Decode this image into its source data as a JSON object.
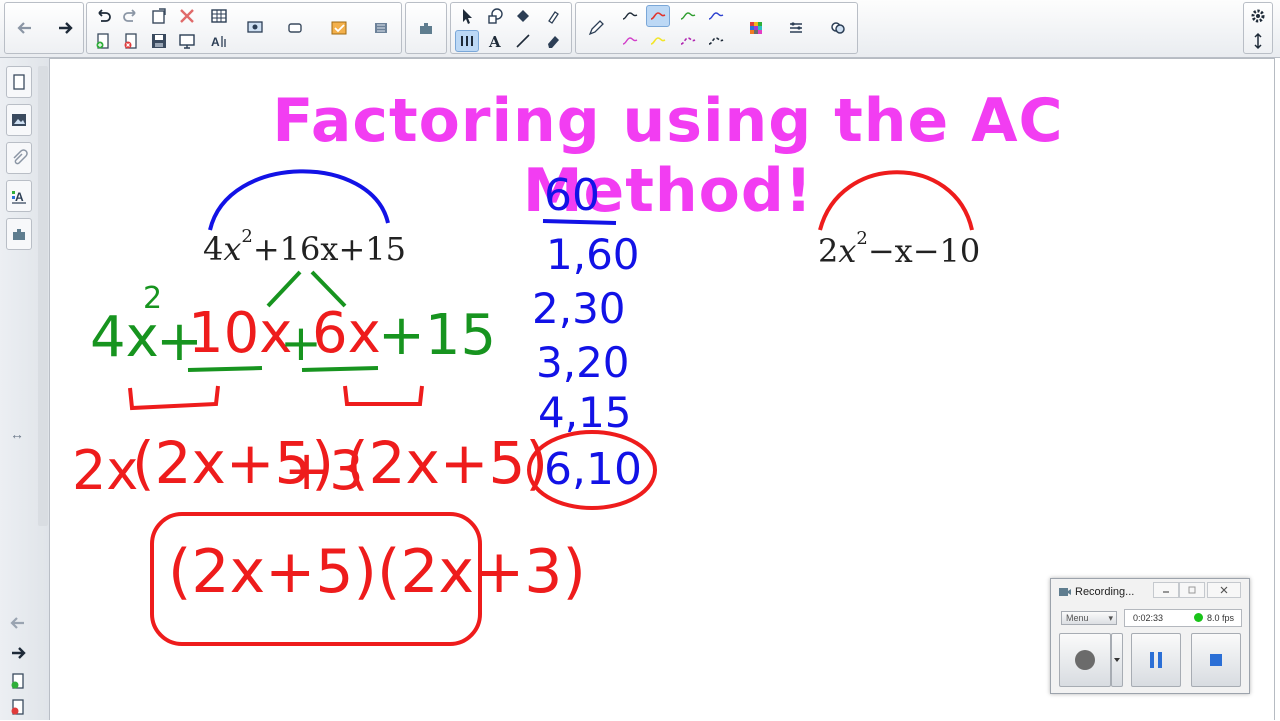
{
  "toolbar": {
    "groups": [
      "navigation",
      "edit",
      "insert",
      "pointer-shapes",
      "pens",
      "settings"
    ],
    "icons": [
      "back-arrow-icon",
      "forward-arrow-icon",
      "undo-icon",
      "redo-icon",
      "paste-icon",
      "delete-icon",
      "table-icon",
      "add-page-icon",
      "delete-page-icon",
      "save-icon",
      "screen-shade-icon",
      "text-recognition-icon",
      "capture-icon",
      "screen-icon",
      "response-icon",
      "activity-icon",
      "addons-icon",
      "select-icon",
      "shapes-icon",
      "fill-icon",
      "eraser-drop-icon",
      "measure-icon",
      "text-icon",
      "line-icon",
      "eraser-icon",
      "pen-icon",
      "pen-style-icon",
      "color-palette-icon",
      "properties-icon",
      "link-icon",
      "gear-icon",
      "move-toolbar-icon"
    ]
  },
  "sidebar": {
    "tabs": [
      "page-sorter-icon",
      "gallery-icon",
      "attachments-icon",
      "properties-icon",
      "addons-icon"
    ],
    "resize_glyph": "↔"
  },
  "page": {
    "title": "Factoring using the AC Method!",
    "colors": {
      "title": "#f23df2",
      "blue": "#1212e6",
      "red": "#ee1c1c",
      "green": "#17941f",
      "ink": "#222222"
    },
    "problem1": {
      "coef": "4",
      "var": "x",
      "exp": "2",
      "rest": "+16x+15"
    },
    "problem2": {
      "coef": "2",
      "var": "x",
      "exp": "2",
      "rest": "−x−10"
    },
    "ac_product": "60",
    "factor_pairs": [
      "1,60",
      "2,30",
      "3,20",
      "4,15",
      "6,10"
    ],
    "split_terms": [
      "4x",
      "2",
      "+",
      "10x",
      "+",
      "6x",
      "+15"
    ],
    "grouped": [
      "2x",
      "(2x+5)",
      "+3",
      "(2x+5)"
    ],
    "answer": "(2x+5)(2x+3)"
  },
  "recorder": {
    "title": "Recording...",
    "menu_label": "Menu",
    "elapsed": "0:02:33",
    "fps": "8.0 fps",
    "status_color": "#19c419"
  }
}
